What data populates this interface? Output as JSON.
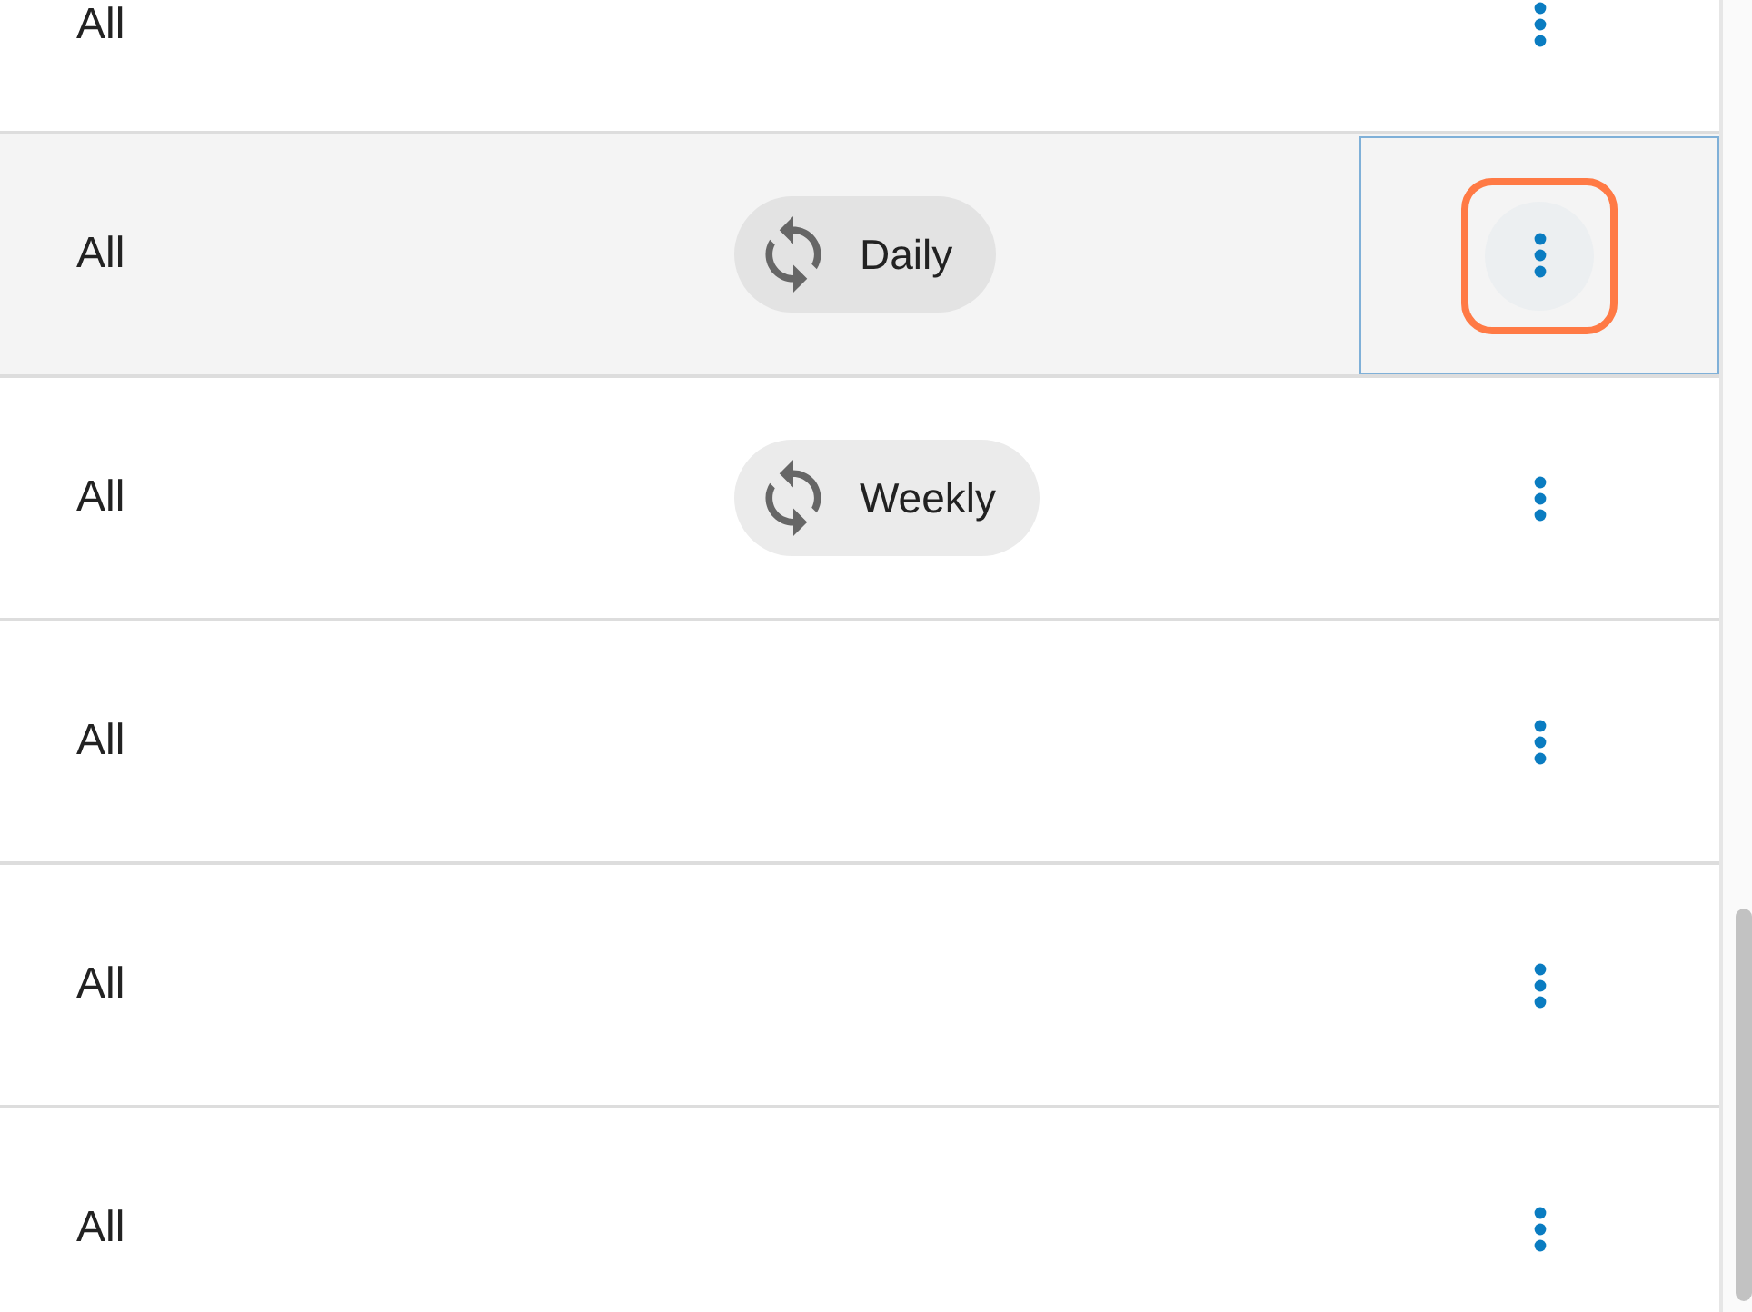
{
  "rows": [
    {
      "column_1": "All",
      "selected": false
    },
    {
      "column_1": "All",
      "chip": "Daily",
      "selected": true
    },
    {
      "column_1": "All",
      "chip": "Weekly",
      "selected": false
    },
    {
      "column_1": "All",
      "selected": false
    },
    {
      "column_1": "All",
      "selected": false
    },
    {
      "column_1": "All",
      "selected": false
    }
  ]
}
